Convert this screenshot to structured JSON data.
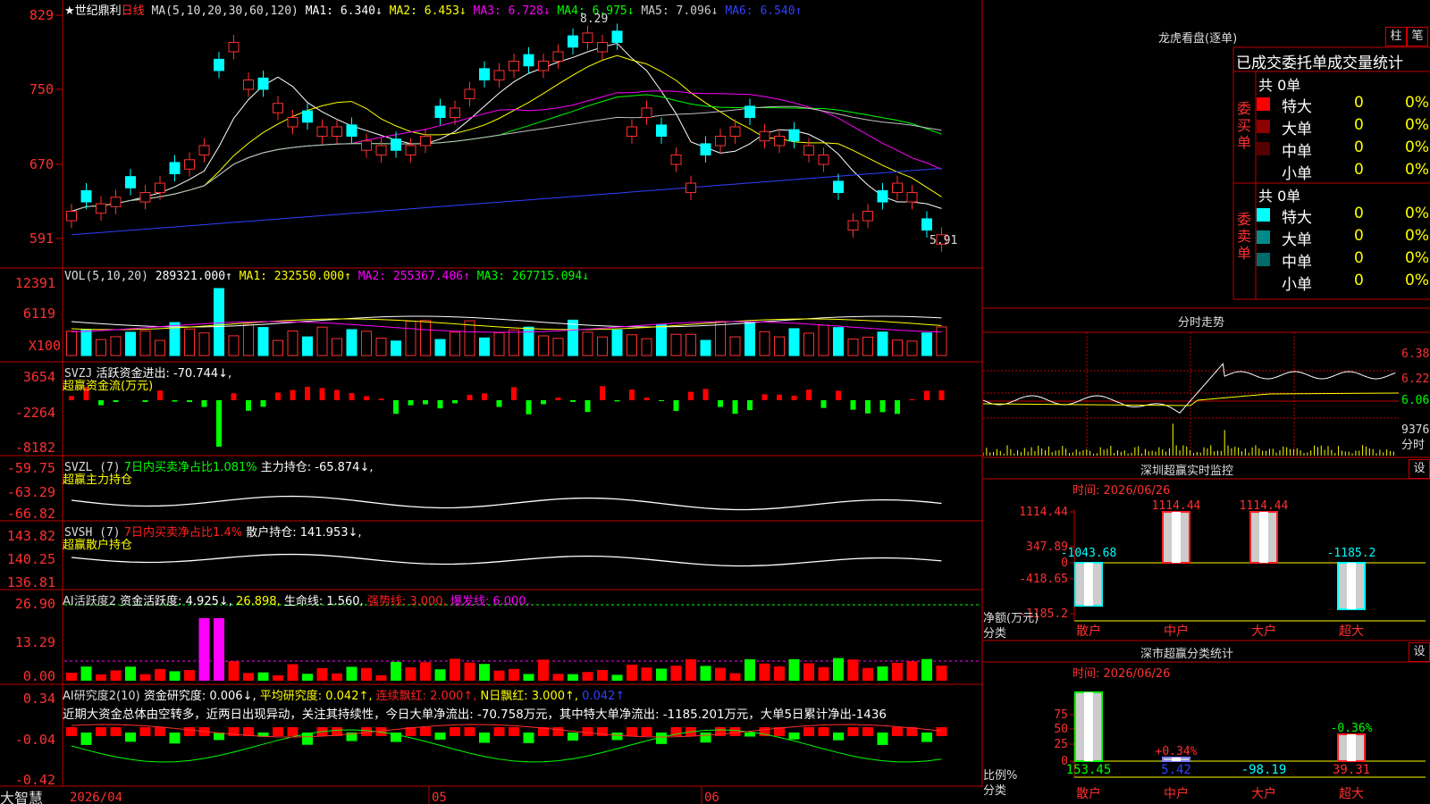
{
  "app": {
    "logo": "大智慧"
  },
  "main": {
    "title_star": "★世纪鼎利",
    "period": "日线",
    "ma_label": "MA(5,10,20,30,60,120)",
    "ma_values": [
      {
        "text": "MA1: 6.340↓",
        "color": "#ffffff"
      },
      {
        "text": "MA2: 6.453↓",
        "color": "#ffff00"
      },
      {
        "text": "MA3: 6.728↓",
        "color": "#ff00ff"
      },
      {
        "text": "MA4: 6.975↓",
        "color": "#00ff00"
      },
      {
        "text": "MA5: 7.096↓",
        "color": "#c0c0c0"
      },
      {
        "text": "MA6: 6.540↑",
        "color": "#3030ff"
      }
    ],
    "high_label": "8.29",
    "low_label": "5.91",
    "y_ticks": [
      "829",
      "750",
      "670",
      "591"
    ],
    "x_labels": [
      "2026/04",
      "05",
      "06"
    ]
  },
  "vol": {
    "label": "VOL(5,10,20)",
    "value": "289321.000↑",
    "ma1": "MA1: 232550.000↑",
    "ma2": "MA2: 255367.406↑",
    "ma3": "MA3: 267715.094↓",
    "y_ticks": [
      "12391",
      "6119",
      "X100"
    ]
  },
  "svzj": {
    "label": "SVZJ",
    "line1": "活跃资金进出: -70.744↓,",
    "line2": "超赢资金流(万元)",
    "y_ticks": [
      "3654",
      "-2264",
      "-8182"
    ]
  },
  "svzl": {
    "label": "SVZL (7)",
    "net": "7日内买卖净占比1.081%",
    "hold": "主力持仓: -65.874↓,",
    "line2": "超赢主力持仓",
    "y_ticks": [
      "-59.75",
      "-63.29",
      "-66.82"
    ]
  },
  "svsh": {
    "label": "SVSH (7)",
    "net": "7日内买卖净占比1.4%",
    "hold": "散户持仓: 141.953↓,",
    "line2": "超赢散户持仓",
    "y_ticks": [
      "143.82",
      "140.25",
      "136.81"
    ]
  },
  "ai1": {
    "label": "AI活跃度2",
    "v1": "资金活跃度: 4.925↓,",
    "v2": "26.898,",
    "v3": "生命线: 1.560,",
    "v4": "强势线: 3.000,",
    "v5": "爆发线: 6.000,",
    "y_ticks": [
      "26.90",
      "13.29",
      "0.00"
    ]
  },
  "ai2": {
    "label": "AI研究度2(10)",
    "v1": "资金研究度: 0.006↓,",
    "v2": "平均研究度: 0.042↑,",
    "v3": "连续飘红: 2.000↑,",
    "v4": "N日飘红: 3.000↑,",
    "v5": "0.042↑",
    "comment": "近期大资金总体由空转多，近两日出现异动，关注其持续性，今日大单净流出: -70.758万元，其中特大单净流出: -1185.201万元，大单5日累计净出-1436",
    "y_ticks": [
      "0.34",
      "-0.04",
      "-0.42"
    ]
  },
  "dragon": {
    "title": "龙虎看盘(逐单)",
    "tab1": "柱",
    "tab2": "笔",
    "header": "已成交委托单成交量统计",
    "buy_side": "委买单",
    "sell_side": "委卖单",
    "buy_total": "共 0单",
    "sell_total": "共 0单",
    "buy_rows": [
      {
        "name": "特大",
        "count": "0",
        "pct": "0%",
        "color": "#ff0000"
      },
      {
        "name": "大单",
        "count": "0",
        "pct": "0%",
        "color": "#8b0000"
      },
      {
        "name": "中单",
        "count": "0",
        "pct": "0%",
        "color": "#550000"
      },
      {
        "name": "小单",
        "count": "0",
        "pct": "0%",
        "color": ""
      }
    ],
    "sell_rows": [
      {
        "name": "特大",
        "count": "0",
        "pct": "0%",
        "color": "#00ffff"
      },
      {
        "name": "大单",
        "count": "0",
        "pct": "0%",
        "color": "#008b8b"
      },
      {
        "name": "中单",
        "count": "0",
        "pct": "0%",
        "color": "#006b6b"
      },
      {
        "name": "小单",
        "count": "0",
        "pct": "0%",
        "color": ""
      }
    ]
  },
  "intraday": {
    "title": "分时走势",
    "y_ticks": [
      "6.38",
      "6.22",
      "6.06"
    ],
    "vol_label": "9376",
    "vol_unit": "分时"
  },
  "monitor": {
    "title": "深圳超赢实时监控",
    "set": "设",
    "date": "时间: 2026/06/26",
    "y_ticks": [
      "1114.44",
      "347.89",
      "0",
      "-418.65",
      "-1185.2"
    ],
    "bar_labels": [
      "-1043.68",
      "1114.44",
      "1114.44",
      "-1185.2"
    ],
    "axis_title1": "净额(万元)",
    "axis_title2": "分类",
    "categories": [
      "散户",
      "中户",
      "大户",
      "超大"
    ]
  },
  "classify": {
    "title": "深市超赢分类统计",
    "set": "设",
    "date": "时间: 2026/06/26",
    "y_ticks": [
      "75",
      "50",
      "25",
      "0"
    ],
    "top_labels": [
      "+0.34%",
      "-0.36%"
    ],
    "bottom_values": [
      "153.45",
      "5.42",
      "-98.19",
      "39.31"
    ],
    "axis_title1": "比例%",
    "axis_title2": "分类",
    "categories": [
      "散户",
      "中户",
      "大户",
      "超大"
    ]
  }
}
